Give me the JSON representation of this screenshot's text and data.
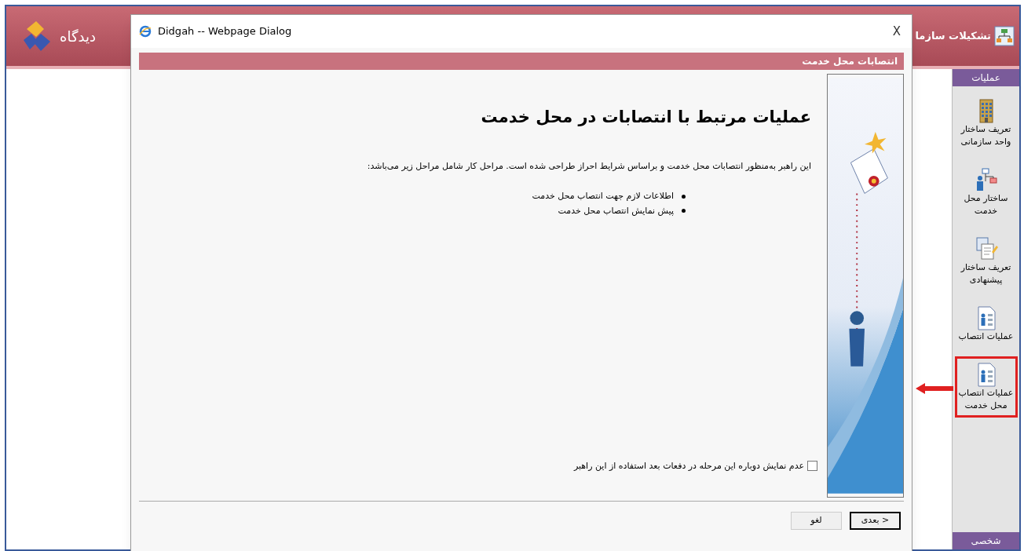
{
  "app": {
    "logo_text": "دیدگاه",
    "title": "تشکیلات سازما"
  },
  "sidebar": {
    "section_title": "عملیات",
    "footer_section": "شخصی",
    "items": [
      {
        "label": "تعریف ساختار واحد سازمانی",
        "highlighted": false
      },
      {
        "label": "ساختار محل خدمت",
        "highlighted": false
      },
      {
        "label": "تعریف ساختار پیشنهادی",
        "highlighted": false
      },
      {
        "label": "عملیات انتصاب",
        "highlighted": false
      },
      {
        "label": "عملیات انتصاب محل خدمت",
        "highlighted": true
      }
    ]
  },
  "dialog": {
    "title": "Didgah -- Webpage Dialog",
    "close": "X",
    "header": "انتصابات محل خدمت",
    "heading": "عملیات مرتبط با انتصابات در محل خدمت",
    "intro": "این راهبر به‌منظور انتصابات محل خدمت و براساس شرایط احراز طراحی شده است. مراحل کار شامل مراحل زیر می‌باشد:",
    "steps": [
      "اطلاعات لازم جهت انتصاب محل خدمت",
      "پیش نمایش انتصاب محل خدمت"
    ],
    "dont_show_again": {
      "label": "عدم نمایش دوباره این مرحله در دفعات بعد استفاده از این راهبر",
      "checked": false
    },
    "buttons": [
      {
        "label": "بعدی >",
        "default": true
      },
      {
        "label": "لغو",
        "default": false
      }
    ]
  }
}
